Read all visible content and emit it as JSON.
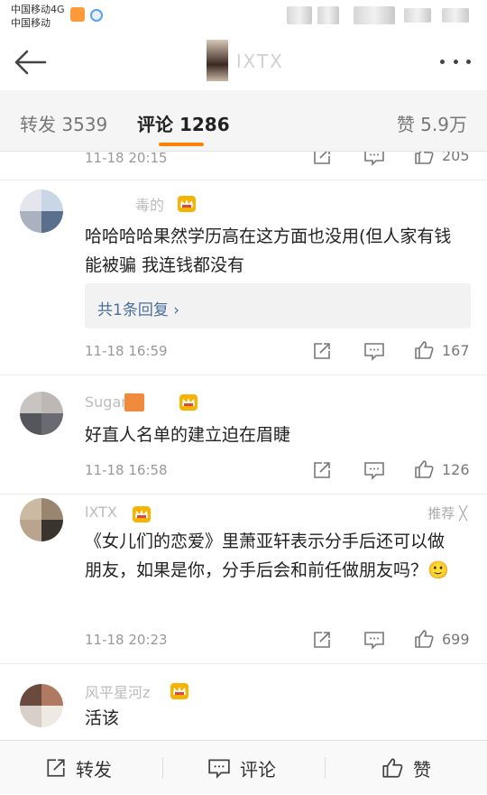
{
  "status": {
    "carrier_line1": "中国移动4G",
    "carrier_line2": "中国移动"
  },
  "nav": {
    "title": "lXTX"
  },
  "tabs": {
    "repost": "转发 3539",
    "comment": "评论 1286",
    "like": "赞 5.9万"
  },
  "comments": [
    {
      "time": "11-18 20:15",
      "likes": "205"
    },
    {
      "username": "毒的",
      "text": "哈哈哈哈果然学历高在这方面也没用(但人家有钱能被骗 我连钱都没有",
      "reply_label": "共1条回复 ›",
      "time": "11-18 16:59",
      "likes": "167"
    },
    {
      "username": "Sugar r",
      "text": "好直人名单的建立迫在眉睫",
      "time": "11-18 16:58",
      "likes": "126"
    },
    {
      "username": "lXTX",
      "recommend": "推荐 ╳",
      "text": "《女儿们的恋爱》里萧亚轩表示分手后还可以做朋友，如果是你，分手后会和前任做朋友吗？🙂",
      "time": "11-18 20:23",
      "likes": "699"
    },
    {
      "username": "风平星河z",
      "text": "活该"
    }
  ],
  "bottom": {
    "repost": "转发",
    "comment": "评论",
    "like": "赞"
  },
  "colors": {
    "accent": "#ff8200",
    "link": "#4a6f9a",
    "crown": "#f6b400"
  }
}
